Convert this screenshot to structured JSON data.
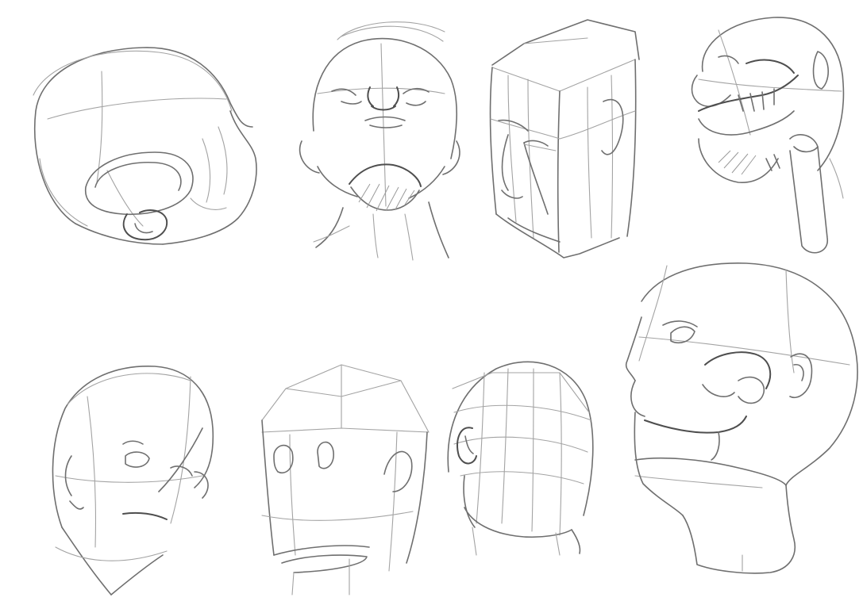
{
  "canvas": {
    "background": "#ffffff",
    "stroke_color": "#6f6f6f",
    "light_stroke_color": "#a3a3a3"
  },
  "sketches": [
    {
      "id": "skull-top-view",
      "subject": "skull"
    },
    {
      "id": "head-looking-up",
      "subject": "head"
    },
    {
      "id": "box-head-three-quarter",
      "subject": "head"
    },
    {
      "id": "skull-tilted-back",
      "subject": "skull"
    },
    {
      "id": "head-three-quarter-down",
      "subject": "head"
    },
    {
      "id": "box-head-front",
      "subject": "head"
    },
    {
      "id": "head-back-view",
      "subject": "head"
    },
    {
      "id": "bald-head-looking-up",
      "subject": "head"
    }
  ]
}
